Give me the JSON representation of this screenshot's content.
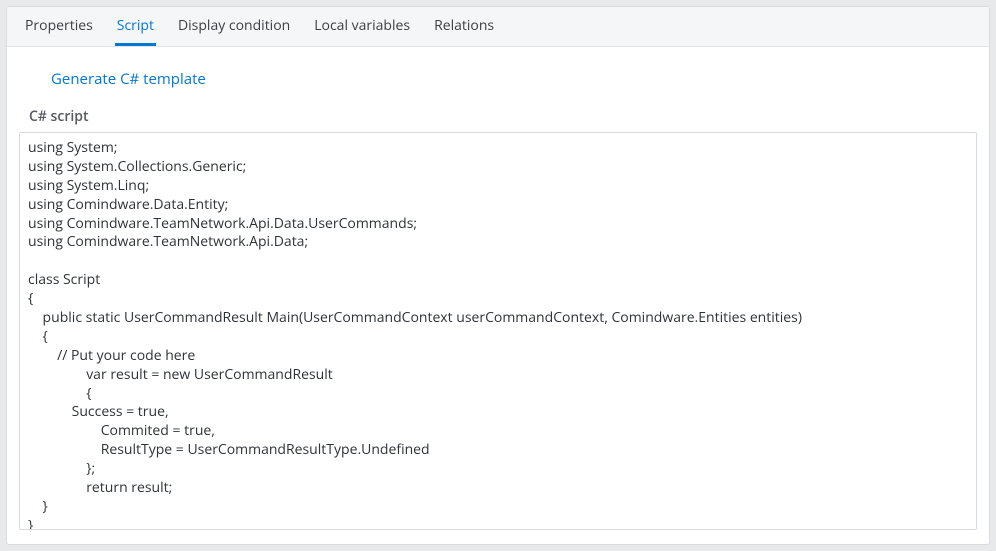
{
  "tabs": [
    {
      "label": "Properties",
      "active": false
    },
    {
      "label": "Script",
      "active": true
    },
    {
      "label": "Display condition",
      "active": false
    },
    {
      "label": "Local variables",
      "active": false
    },
    {
      "label": "Relations",
      "active": false
    }
  ],
  "actions": {
    "generate_template": "Generate С# template"
  },
  "section": {
    "script_label": "С# script"
  },
  "code": "using System;\nusing System.Collections.Generic;\nusing System.Linq;\nusing Comindware.Data.Entity;\nusing Comindware.TeamNetwork.Api.Data.UserCommands;\nusing Comindware.TeamNetwork.Api.Data;\n\nclass Script\n{\n    public static UserCommandResult Main(UserCommandContext userCommandContext, Comindware.Entities entities)\n    {\n        // Put your code here\n                var result = new UserCommandResult\n                {\n            Success = true,\n                    Commited = true,\n                    ResultType = UserCommandResultType.Undefined\n                };\n                return result;\n    }\n}"
}
